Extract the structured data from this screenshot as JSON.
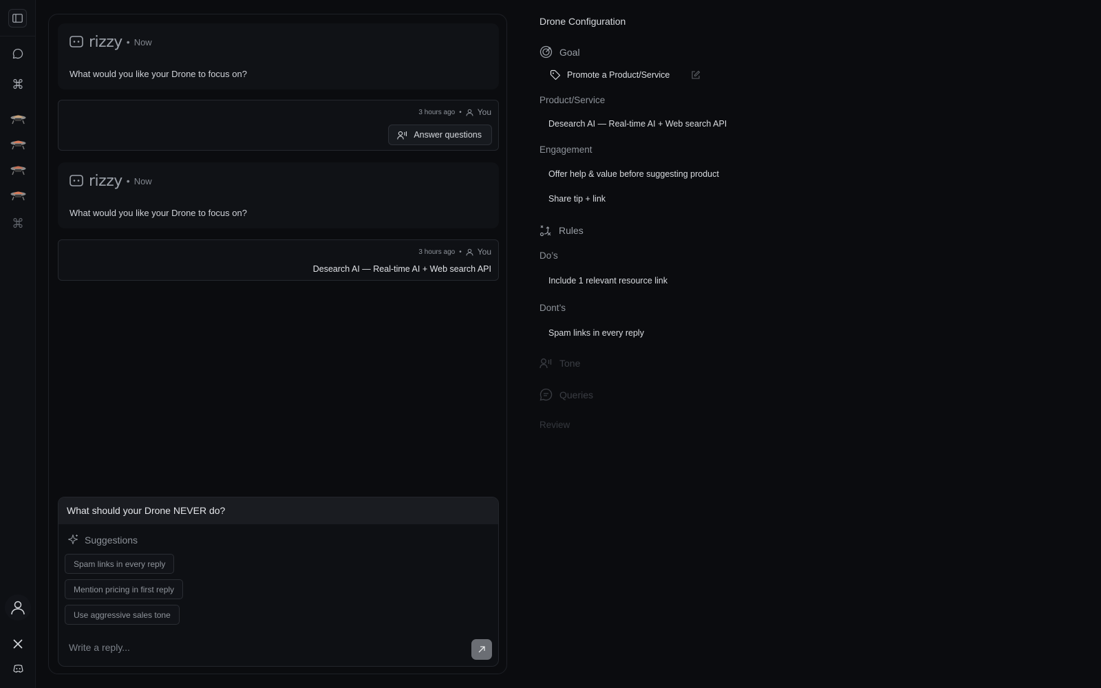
{
  "sidebar": {
    "items": [
      {
        "name": "chat-icon"
      },
      {
        "name": "command-icon"
      },
      {
        "name": "drone-avatar-1"
      },
      {
        "name": "drone-avatar-2"
      },
      {
        "name": "drone-avatar-3"
      },
      {
        "name": "drone-avatar-4"
      },
      {
        "name": "command-icon-dim"
      }
    ],
    "bottom": [
      "user-icon",
      "x-icon",
      "discord-icon"
    ]
  },
  "chat": {
    "messages": [
      {
        "role": "bot",
        "brand": "rizzy",
        "time": "Now",
        "text": "What would you like your Drone to focus on?"
      },
      {
        "role": "user",
        "time": "3 hours ago",
        "author": "You",
        "action_label": "Answer questions"
      },
      {
        "role": "bot",
        "brand": "rizzy",
        "time": "Now",
        "text": "What would you like your Drone to focus on?"
      },
      {
        "role": "user",
        "time": "3 hours ago",
        "author": "You",
        "text": "Desearch AI — Real-time AI + Web search API"
      }
    ],
    "composer": {
      "question": "What should your Drone NEVER do?",
      "suggestions_label": "Suggestions",
      "suggestions": [
        "Spam links in every reply",
        "Mention pricing in first reply",
        "Use aggressive sales tone"
      ],
      "placeholder": "Write a reply..."
    }
  },
  "config": {
    "title": "Drone Configuration",
    "goal": {
      "label": "Goal",
      "value": "Promote a Product/Service"
    },
    "product": {
      "label": "Product/Service",
      "value": "Desearch AI — Real-time AI + Web search API"
    },
    "engagement": {
      "label": "Engagement",
      "items": [
        "Offer help & value before suggesting product",
        "Share tip + link"
      ]
    },
    "rules": {
      "label": "Rules"
    },
    "dos": {
      "label": "Do’s",
      "items": [
        "Include 1 relevant resource link"
      ]
    },
    "donts": {
      "label": "Dont’s",
      "items": [
        "Spam links in every reply"
      ]
    },
    "tone": {
      "label": "Tone"
    },
    "queries": {
      "label": "Queries"
    },
    "review": {
      "label": "Review"
    }
  },
  "colors": {
    "background": "#0b0c0f",
    "panel": "#101216",
    "send_button": "#6b6e74"
  }
}
